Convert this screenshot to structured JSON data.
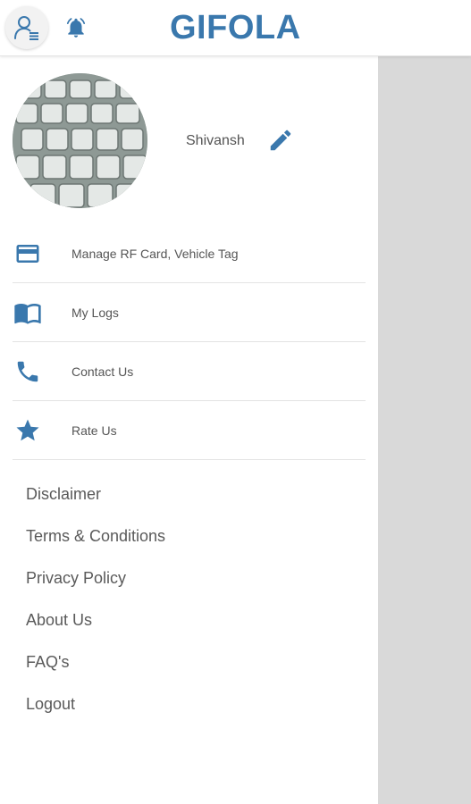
{
  "header": {
    "title": "GIFOLA",
    "icons": {
      "profile": "user-list-icon",
      "notifications": "bell-icon"
    }
  },
  "drawer": {
    "user_name": "Shivansh",
    "avatar": "keyboard-photo",
    "menu": [
      {
        "label": "Manage RF Card, Vehicle Tag",
        "icon": "credit-card-icon"
      },
      {
        "label": "My Logs",
        "icon": "book-icon"
      },
      {
        "label": "Contact Us",
        "icon": "phone-icon"
      },
      {
        "label": "Rate Us",
        "icon": "star-icon"
      }
    ],
    "links": [
      "Disclaimer",
      "Terms & Conditions",
      "Privacy Policy",
      "About Us",
      "FAQ's",
      "Logout"
    ]
  },
  "colors": {
    "accent": "#3a78ad",
    "overlay": "#d9d9d9",
    "text": "#555555"
  }
}
